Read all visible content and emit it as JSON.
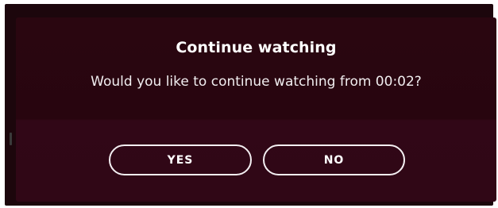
{
  "dialog": {
    "title": "Continue watching",
    "message": "Would you like to continue watching from 00:02?",
    "yes_label": "YES",
    "no_label": "NO"
  },
  "colors": {
    "background": "#1c060c",
    "dialog_top": "#2a0610",
    "dialog_bottom": "#310717",
    "text": "#ffffff",
    "button_border": "#f3eef1"
  }
}
